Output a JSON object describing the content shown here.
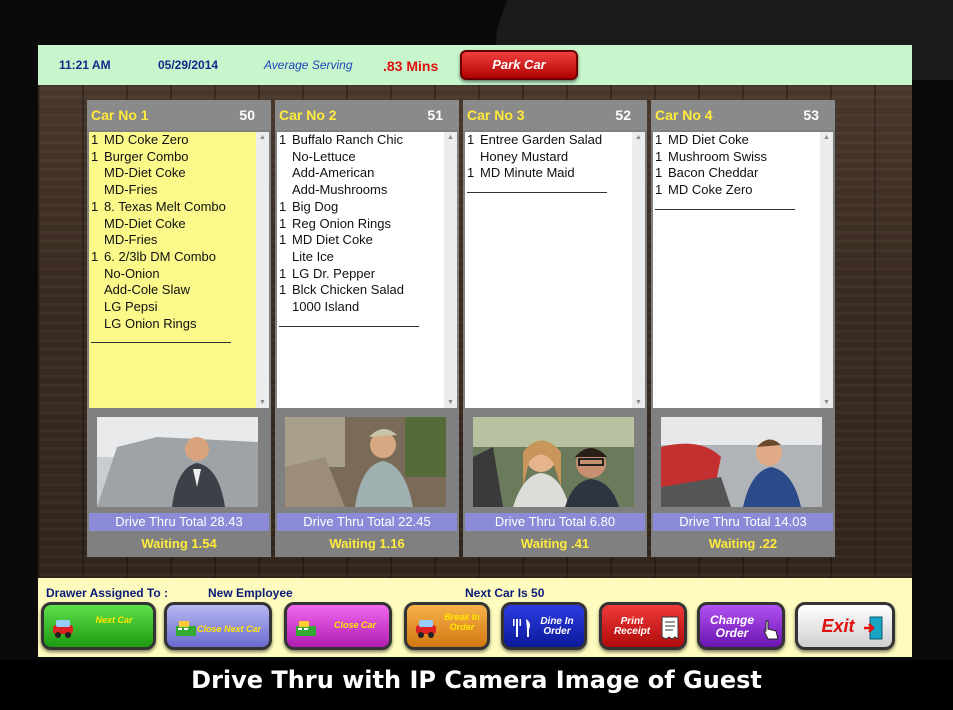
{
  "topbar": {
    "time": "11:21 AM",
    "date": "05/29/2014",
    "avg_label": "Average Serving",
    "avg_value": ".83 Mins",
    "park_button": "Park Car"
  },
  "cars": [
    {
      "name": "Car No 1",
      "number": "50",
      "total": "Drive Thru Total 28.43",
      "waiting": "Waiting 1.54",
      "items": [
        {
          "q": "1",
          "text": "MD Coke Zero"
        },
        {
          "q": "1",
          "text": "Burger Combo"
        },
        {
          "q": "",
          "text": "MD-Diet Coke"
        },
        {
          "q": "",
          "text": "MD-Fries"
        },
        {
          "q": "1",
          "text": "8. Texas Melt Combo"
        },
        {
          "q": "",
          "text": "MD-Diet Coke"
        },
        {
          "q": "",
          "text": "MD-Fries"
        },
        {
          "q": "1",
          "text": "6. 2/3lb DM Combo"
        },
        {
          "q": "",
          "text": "No-Onion"
        },
        {
          "q": "",
          "text": "Add-Cole Slaw"
        },
        {
          "q": "",
          "text": "LG Pepsi"
        },
        {
          "q": "",
          "text": "LG Onion Rings"
        }
      ]
    },
    {
      "name": "Car No 2",
      "number": "51",
      "total": "Drive Thru Total 22.45",
      "waiting": "Waiting 1.16",
      "items": [
        {
          "q": "1",
          "text": "Buffalo Ranch Chic"
        },
        {
          "q": "",
          "text": "No-Lettuce"
        },
        {
          "q": "",
          "text": "Add-American"
        },
        {
          "q": "",
          "text": "Add-Mushrooms"
        },
        {
          "q": "1",
          "text": "Big Dog"
        },
        {
          "q": "1",
          "text": "Reg Onion Rings"
        },
        {
          "q": "1",
          "text": "MD Diet Coke"
        },
        {
          "q": "",
          "text": "Lite Ice"
        },
        {
          "q": "1",
          "text": "LG Dr. Pepper"
        },
        {
          "q": "1",
          "text": "Blck Chicken Salad"
        },
        {
          "q": "",
          "text": "1000 Island"
        }
      ]
    },
    {
      "name": "Car No 3",
      "number": "52",
      "total": "Drive Thru Total 6.80",
      "waiting": "Waiting .41",
      "items": [
        {
          "q": "1",
          "text": "Entree Garden Salad"
        },
        {
          "q": "",
          "text": "Honey Mustard"
        },
        {
          "q": "1",
          "text": "MD Minute Maid"
        }
      ]
    },
    {
      "name": "Car No 4",
      "number": "53",
      "total": "Drive Thru Total 14.03",
      "waiting": "Waiting .22",
      "items": [
        {
          "q": "1",
          "text": "MD Diet Coke"
        },
        {
          "q": "1",
          "text": "Mushroom Swiss"
        },
        {
          "q": "1",
          "text": "Bacon Cheddar"
        },
        {
          "q": "1",
          "text": "MD Coke Zero"
        }
      ]
    }
  ],
  "bottom": {
    "drawer_label": "Drawer Assigned To :",
    "drawer_value": "New Employee",
    "next_car": "Next Car Is 50",
    "buttons": {
      "next_car": "Next Car",
      "close_next_car": "Close Next Car",
      "close_car": "Close Car",
      "break_in_order": "Break In Order",
      "dine_in_order": "Dine In Order",
      "print_receipt": "Print Receipt",
      "change_order": "Change Order",
      "exit": "Exit"
    }
  },
  "caption": "Drive Thru with IP Camera Image of Guest",
  "colors": {
    "topbar_bg": "#c7f5cc",
    "order_active_bg": "#fbf98a",
    "total_bg": "#8b8bd8",
    "wait_text": "#ffeb3b",
    "bottom_bg": "#fdfbbd"
  }
}
